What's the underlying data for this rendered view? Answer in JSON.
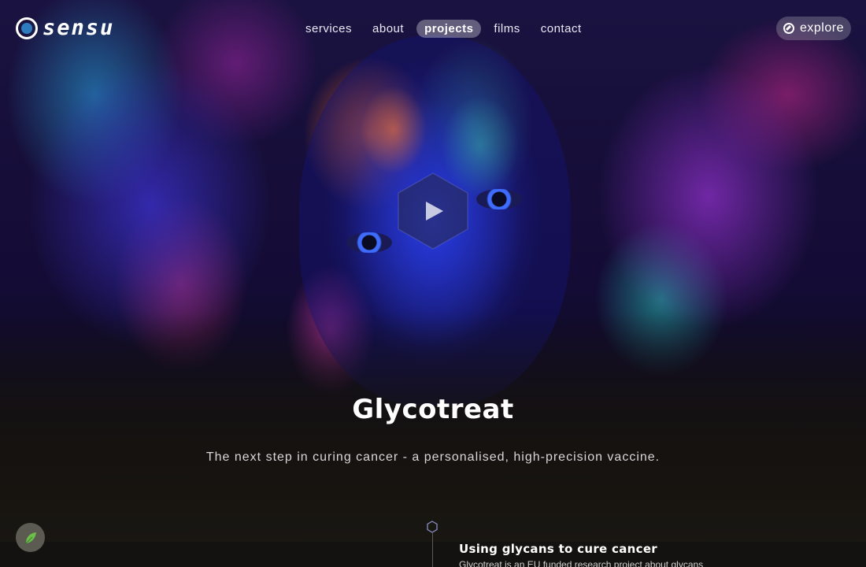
{
  "brand": {
    "logo_text": "sensu",
    "logo_accent_color": "#2e7cbe"
  },
  "nav": {
    "items": [
      {
        "label": "services"
      },
      {
        "label": "about"
      },
      {
        "label": "projects",
        "active": true
      },
      {
        "label": "films"
      },
      {
        "label": "contact"
      }
    ]
  },
  "explore_button": {
    "label": "explore",
    "icon": "compass-icon"
  },
  "hero": {
    "play_icon": "play-icon",
    "title": "Glycotreat",
    "subtitle": "The next step in curing cancer - a personalised, high-precision vaccine."
  },
  "section": {
    "timeline_icon": "hexagon-icon",
    "heading": "Using glycans to cure cancer",
    "text_partial": "Glycotreat is an EU funded research project about glycans"
  },
  "floating_button": {
    "icon": "leaf-icon",
    "color": "#5b5b52",
    "icon_color": "#6cc04a"
  }
}
